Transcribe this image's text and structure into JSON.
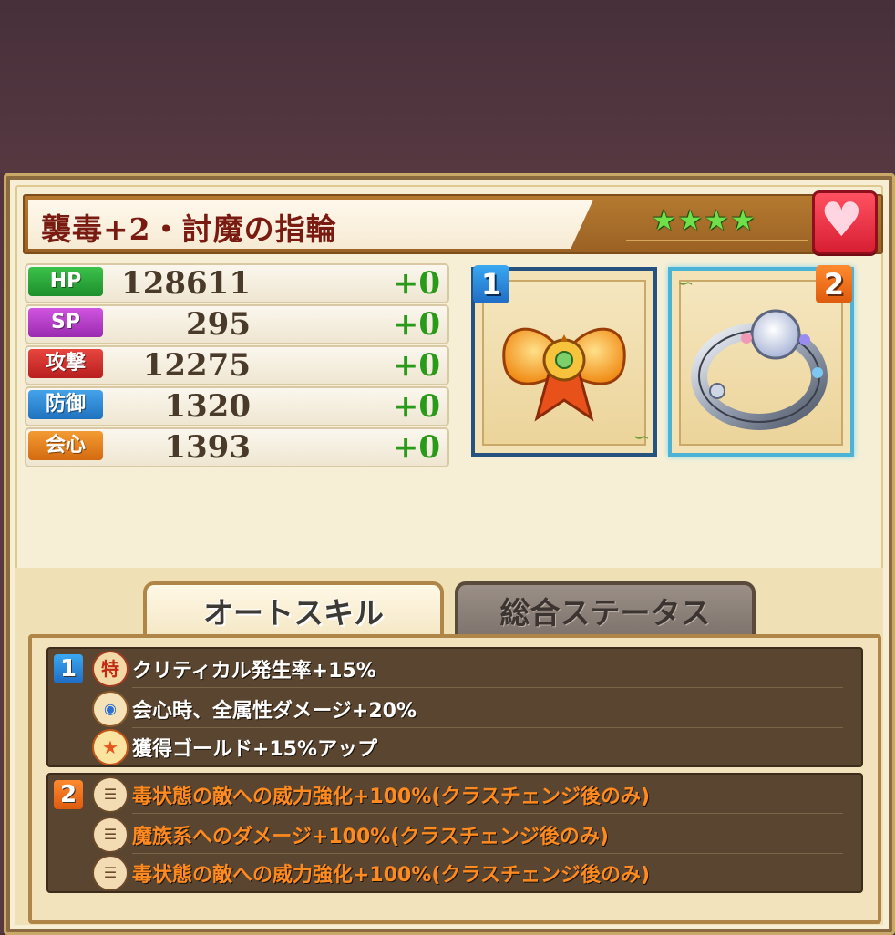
{
  "equipment": {
    "name": "襲毒+2・討魔の指輪",
    "stars": "★★★★",
    "favorite_icon": "heart-icon"
  },
  "stats": [
    {
      "label": "HP",
      "value": "128611",
      "bonus": "+0",
      "color": "#23a335"
    },
    {
      "label": "SP",
      "value": "295",
      "bonus": "+0",
      "color": "#b33bc9"
    },
    {
      "label": "攻撃",
      "value": "12275",
      "bonus": "+0",
      "color": "#cf2d2d"
    },
    {
      "label": "防御",
      "value": "1320",
      "bonus": "+0",
      "color": "#2c8bd6"
    },
    {
      "label": "会心",
      "value": "1393",
      "bonus": "+0",
      "color": "#e8821c"
    }
  ],
  "slots": [
    {
      "num": "1",
      "item_icon": "ribbon-icon"
    },
    {
      "num": "2",
      "item_icon": "ring-icon"
    }
  ],
  "tabs": {
    "auto_skill": "オートスキル",
    "total_status": "総合ステータス"
  },
  "skills": {
    "group1": {
      "num": "1",
      "lines": [
        {
          "icon": "special-icon",
          "text": "クリティカル発生率+15%"
        },
        {
          "icon": "attribute-icon",
          "text": "会心時、全属性ダメージ+20%"
        },
        {
          "icon": "star-icon",
          "text": "獲得ゴールド+15%アップ"
        }
      ]
    },
    "group2": {
      "num": "2",
      "lines": [
        {
          "icon": "tribe-icon",
          "text": "毒状態の敵への威力強化+100%(クラスチェンジ後のみ)"
        },
        {
          "icon": "tribe-icon",
          "text": "魔族系へのダメージ+100%(クラスチェンジ後のみ)"
        },
        {
          "icon": "tribe-icon",
          "text": "毒状態の敵への威力強化+100%(クラスチェンジ後のみ)"
        }
      ]
    }
  },
  "colors": {
    "slot_badge_1": "#1f7fd6",
    "slot_badge_2": "#ee6a14",
    "skill_orange": "#ff8a1f"
  }
}
